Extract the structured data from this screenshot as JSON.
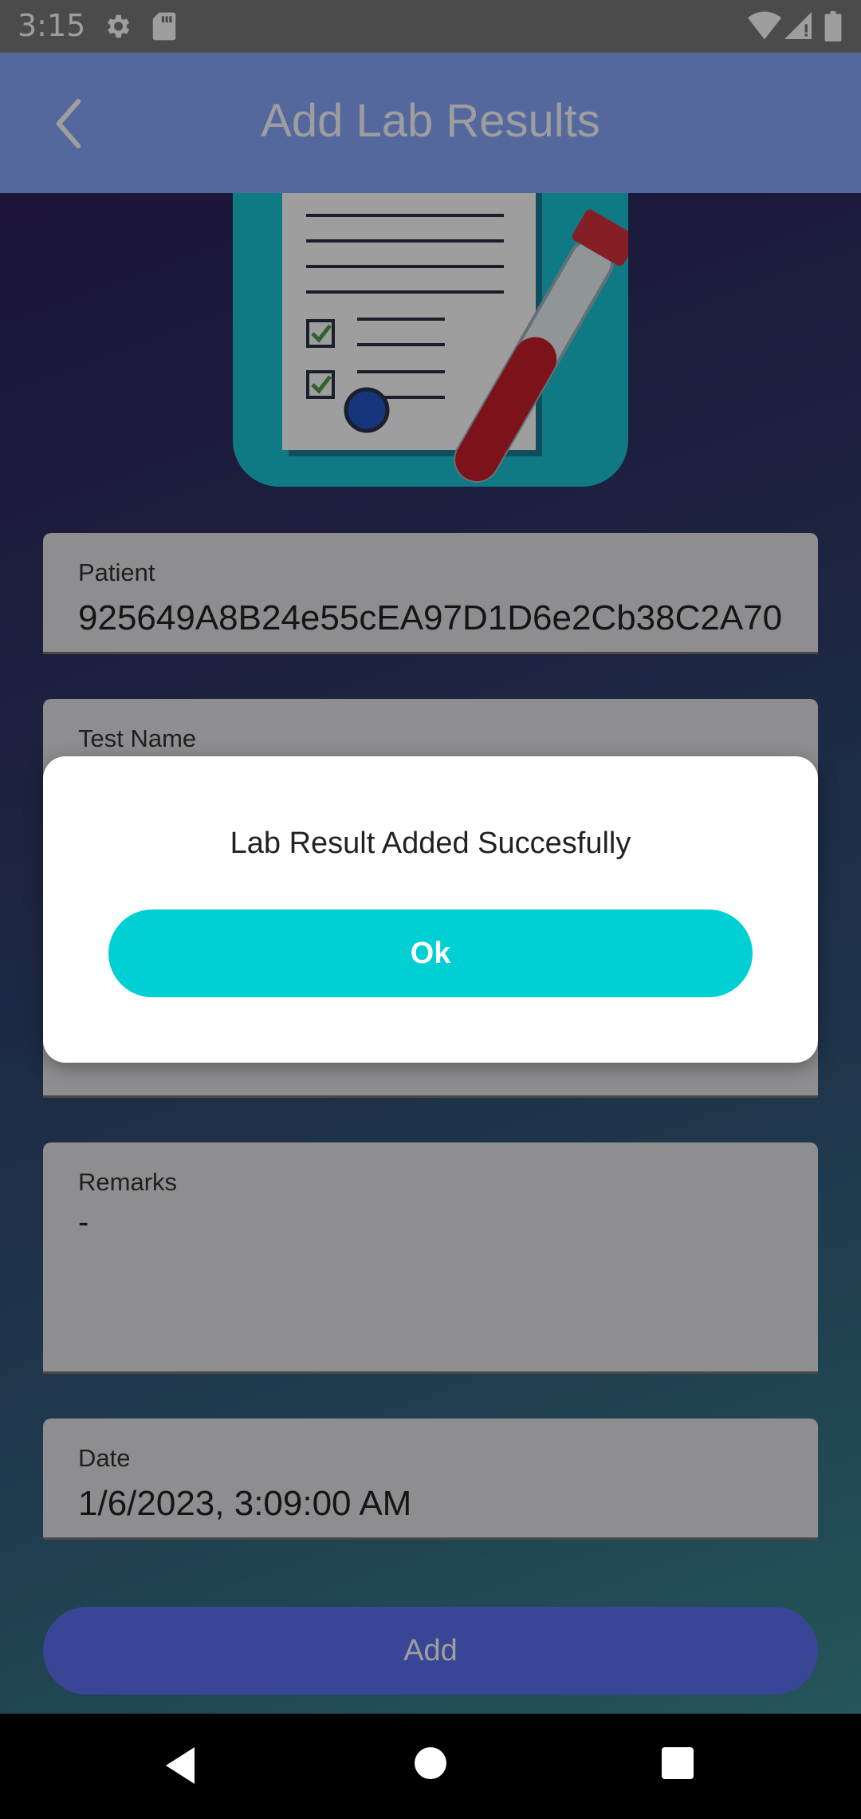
{
  "status_bar": {
    "time": "3:15",
    "icons": [
      "settings-icon",
      "sd-card-icon",
      "wifi-icon",
      "signal-icon",
      "battery-icon"
    ]
  },
  "app_bar": {
    "title": "Add Lab Results",
    "back_icon": "chevron-left-icon",
    "background_color": "#8aa8ff"
  },
  "form": {
    "patient": {
      "label": "Patient",
      "value": "925649A8B24e55cEA97D1D6e2Cb38C2A70"
    },
    "test_name": {
      "label": "Test Name"
    },
    "remarks": {
      "label": "Remarks",
      "value": "-"
    },
    "date": {
      "label": "Date",
      "value": "1/6/2023, 3:09:00 AM"
    },
    "submit_label": "Add"
  },
  "dialog": {
    "message": "Lab Result Added Succesfully",
    "ok_label": "Ok",
    "ok_color": "#00cfd3"
  },
  "nav_bar": {
    "icons": [
      "back-triangle-icon",
      "home-circle-icon",
      "recents-square-icon"
    ]
  }
}
